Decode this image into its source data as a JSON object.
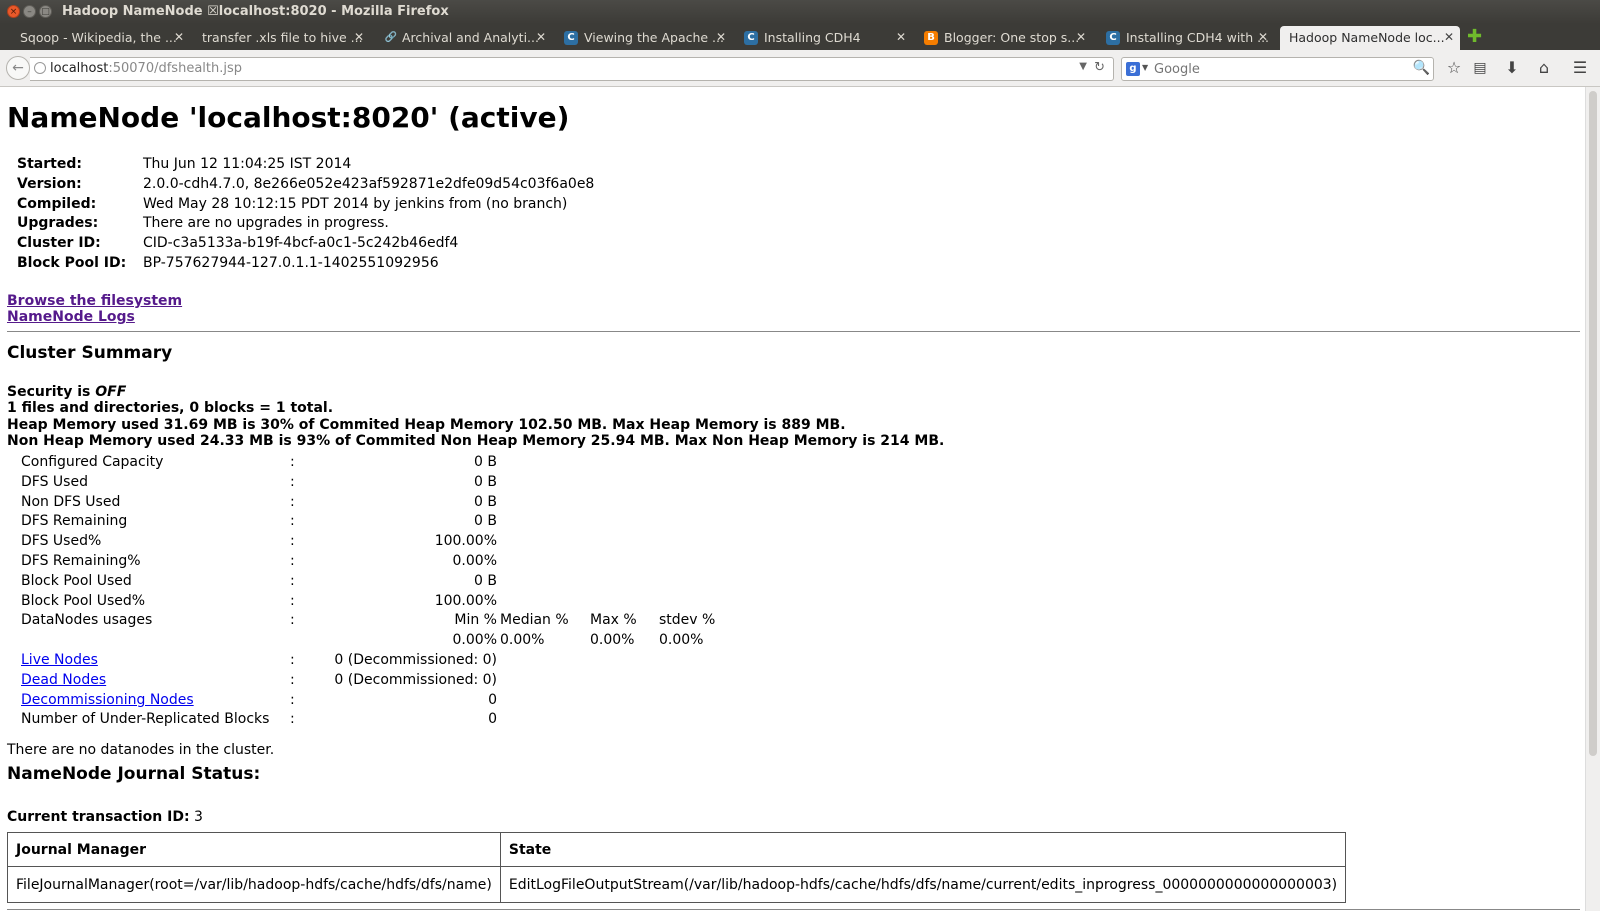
{
  "window": {
    "title": "Hadoop NameNode ☒localhost:8020 - Mozilla Firefox"
  },
  "tabs": [
    {
      "label": "Sqoop - Wikipedia, the ...",
      "icon": "none"
    },
    {
      "label": "transfer .xls file to hive ...",
      "icon": "none"
    },
    {
      "label": "Archival and Analyti...",
      "icon": "link-icon"
    },
    {
      "label": "Viewing the Apache ...",
      "icon": "cloudera-icon"
    },
    {
      "label": "Installing CDH4",
      "icon": "cloudera-icon"
    },
    {
      "label": "Blogger: One stop s...",
      "icon": "blogger-icon"
    },
    {
      "label": "Installing CDH4 with ...",
      "icon": "cloudera-icon"
    },
    {
      "label": "Hadoop NameNode loc...",
      "icon": "none",
      "active": true
    }
  ],
  "nav": {
    "url_host": "localhost",
    "url_rest": ":50070/dfshealth.jsp",
    "search_placeholder": "Google"
  },
  "page": {
    "title": "NameNode 'localhost:8020' (active)",
    "info": [
      {
        "key": "Started:",
        "value": "Thu Jun 12 11:04:25 IST 2014"
      },
      {
        "key": "Version:",
        "value": "2.0.0-cdh4.7.0, 8e266e052e423af592871e2dfe09d54c03f6a0e8"
      },
      {
        "key": "Compiled:",
        "value": "Wed May 28 10:12:15 PDT 2014 by jenkins from (no branch)"
      },
      {
        "key": "Upgrades:",
        "value": "There are no upgrades in progress."
      },
      {
        "key": "Cluster ID:",
        "value": "CID-c3a5133a-b19f-4bcf-a0c1-5c242b46edf4"
      },
      {
        "key": "Block Pool ID:",
        "value": "BP-757627944-127.0.1.1-1402551092956"
      }
    ],
    "links": {
      "browse": "Browse the filesystem",
      "logs": "NameNode Logs"
    },
    "cluster_summary": {
      "heading": "Cluster Summary",
      "security_prefix": "Security is ",
      "security_value": "OFF",
      "files_line": "1 files and directories, 0 blocks = 1 total.",
      "heap_line": "Heap Memory used 31.69 MB is 30% of Commited Heap Memory 102.50 MB. Max Heap Memory is 889 MB.",
      "nonheap_line": "Non Heap Memory used 24.33 MB is 93% of Commited Non Heap Memory 25.94 MB. Max Non Heap Memory is 214 MB.",
      "separator": ":",
      "stats": [
        {
          "label": "Configured Capacity",
          "value": "0 B"
        },
        {
          "label": "DFS Used",
          "value": "0 B"
        },
        {
          "label": "Non DFS Used",
          "value": "0 B"
        },
        {
          "label": "DFS Remaining",
          "value": "0 B"
        },
        {
          "label": "DFS Used%",
          "value": "100.00%"
        },
        {
          "label": "DFS Remaining%",
          "value": "0.00%"
        },
        {
          "label": "Block Pool Used",
          "value": "0 B"
        },
        {
          "label": "Block Pool Used%",
          "value": "100.00%"
        }
      ],
      "datanodes_usages": {
        "label": "DataNodes usages",
        "headers": [
          "Min %",
          "Median %",
          "Max %",
          "stdev %"
        ],
        "values": [
          "0.00%",
          "0.00%",
          "0.00%",
          "0.00%"
        ]
      },
      "node_rows": [
        {
          "label": "Live Nodes",
          "value": "0 (Decommissioned: 0)",
          "link": true
        },
        {
          "label": "Dead Nodes",
          "value": "0 (Decommissioned: 0)",
          "link": true
        },
        {
          "label": "Decommissioning Nodes",
          "value": "0",
          "link": true
        },
        {
          "label": "Number of Under-Replicated Blocks",
          "value": "0",
          "link": false
        }
      ],
      "no_datanodes": "There are no datanodes in the cluster."
    },
    "journal": {
      "heading": "NameNode Journal Status:",
      "txid_label": "Current transaction ID:",
      "txid_value": " 3",
      "columns": [
        "Journal Manager",
        "State"
      ],
      "rows": [
        [
          "FileJournalManager(root=/var/lib/hadoop-hdfs/cache/hdfs/dfs/name)",
          "EditLogFileOutputStream(/var/lib/hadoop-hdfs/cache/hdfs/dfs/name/current/edits_inprogress_0000000000000000003)"
        ]
      ]
    }
  }
}
